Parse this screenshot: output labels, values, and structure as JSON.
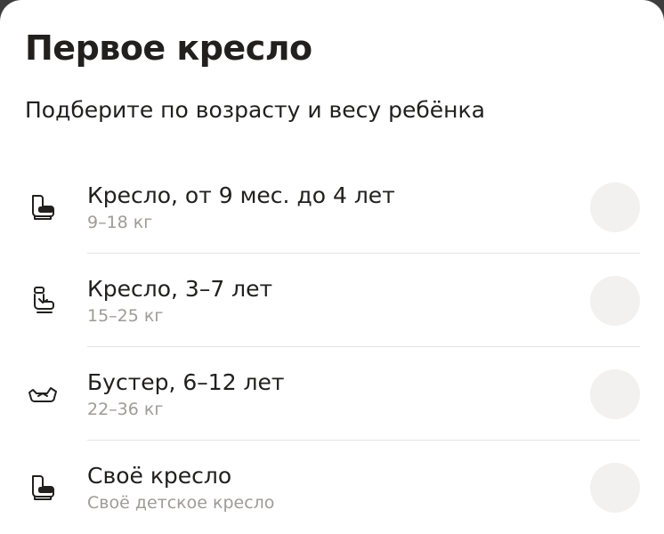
{
  "sheet": {
    "title": "Первое кресло",
    "subtitle": "Подберите по возрасту и весу ребёнка"
  },
  "options": [
    {
      "icon": "car-seat-icon",
      "label": "Кресло, от 9 мес. до 4 лет",
      "sublabel": "9–18 кг"
    },
    {
      "icon": "child-seat-icon",
      "label": "Кресло, 3–7 лет",
      "sublabel": "15–25 кг"
    },
    {
      "icon": "booster-icon",
      "label": "Бустер, 6–12 лет",
      "sublabel": "22–36 кг"
    },
    {
      "icon": "own-seat-icon",
      "label": "Своё кресло",
      "sublabel": "Своё детское кресло"
    }
  ],
  "colors": {
    "text_primary": "#21201f",
    "text_secondary": "#9e9b98",
    "radio_fill": "#f2f1f0",
    "divider": "#e6e4e1"
  }
}
